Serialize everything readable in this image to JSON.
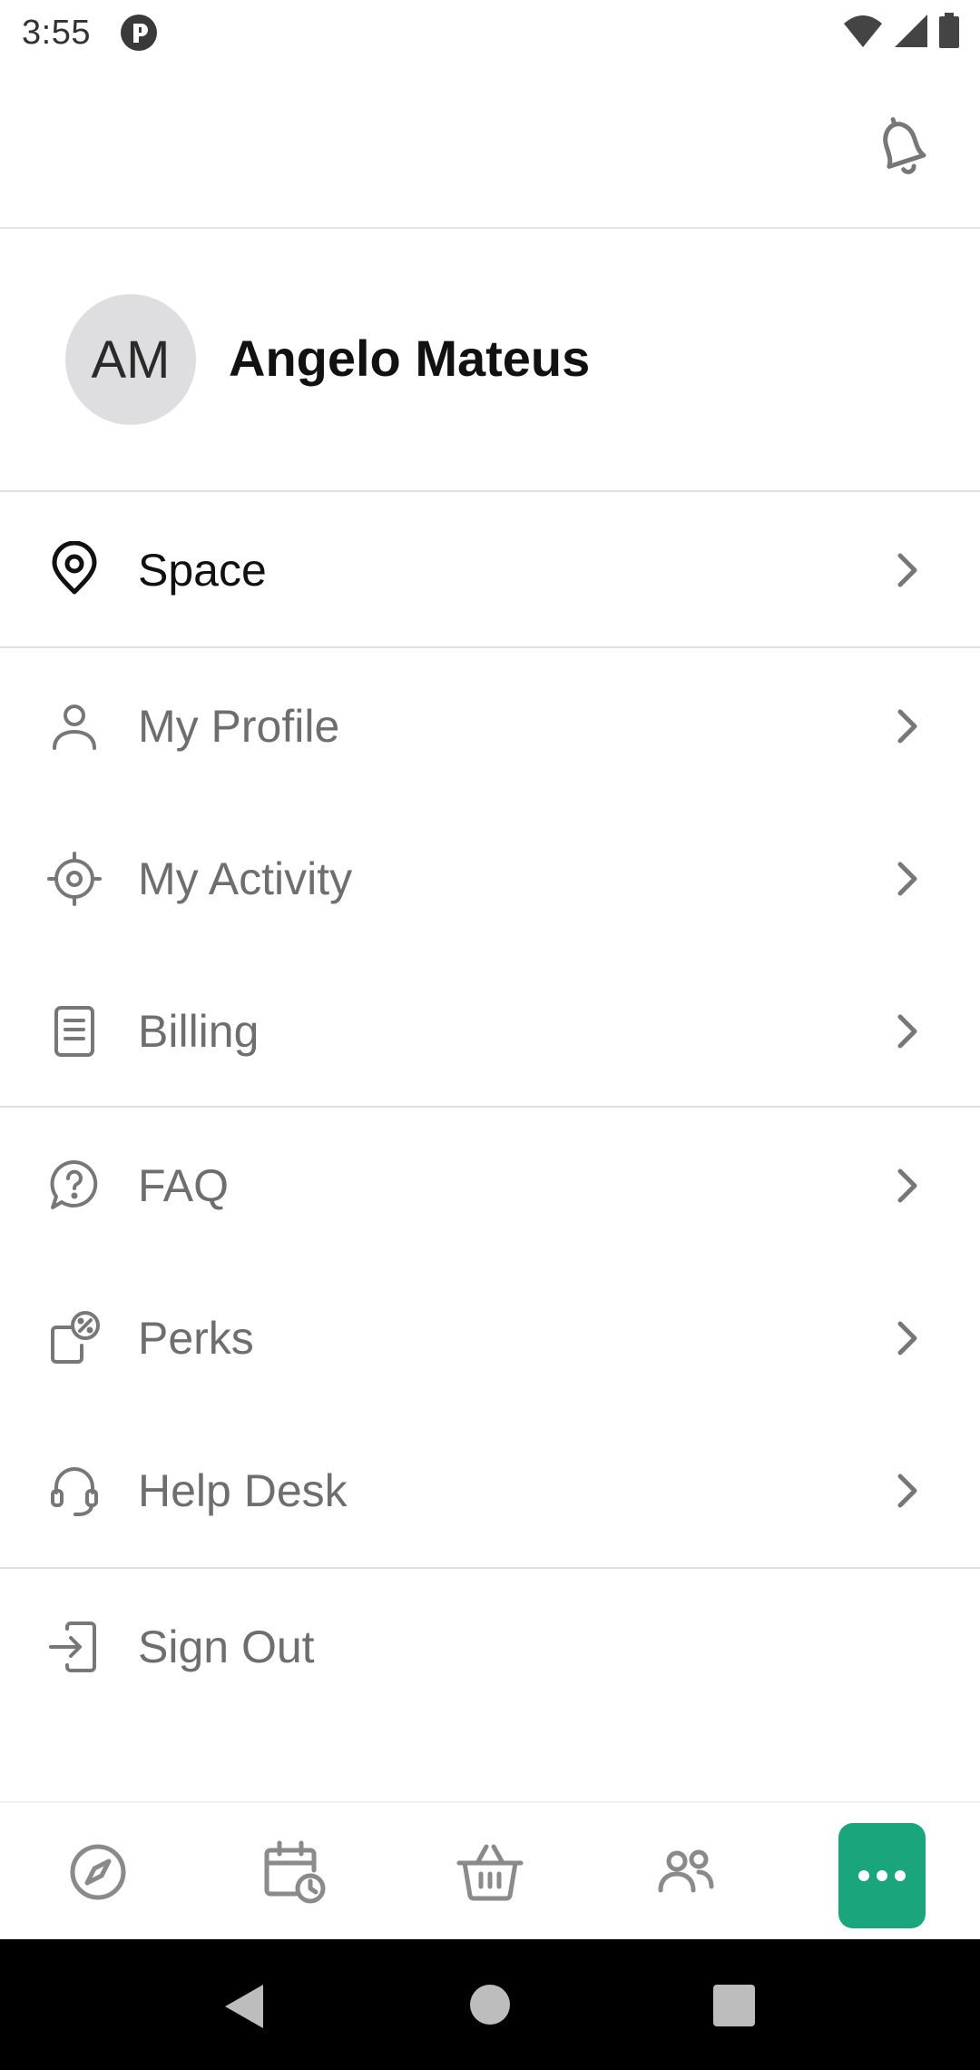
{
  "status_bar": {
    "time": "3:55"
  },
  "profile": {
    "initials": "AM",
    "name": "Angelo Mateus"
  },
  "menu": {
    "space": "Space",
    "my_profile": "My Profile",
    "my_activity": "My Activity",
    "billing": "Billing",
    "faq": "FAQ",
    "perks": "Perks",
    "help_desk": "Help Desk",
    "sign_out": "Sign Out"
  },
  "colors": {
    "accent": "#1aa57d",
    "text_primary": "#111111",
    "text_secondary": "#6e6e6e",
    "avatar_bg": "#dedde0",
    "divider": "#e0e0e0"
  },
  "bottom_nav": {
    "icons": [
      "compass-icon",
      "calendar-clock-icon",
      "basket-icon",
      "people-icon",
      "more-dots-icon"
    ],
    "active": "more-dots-icon"
  }
}
